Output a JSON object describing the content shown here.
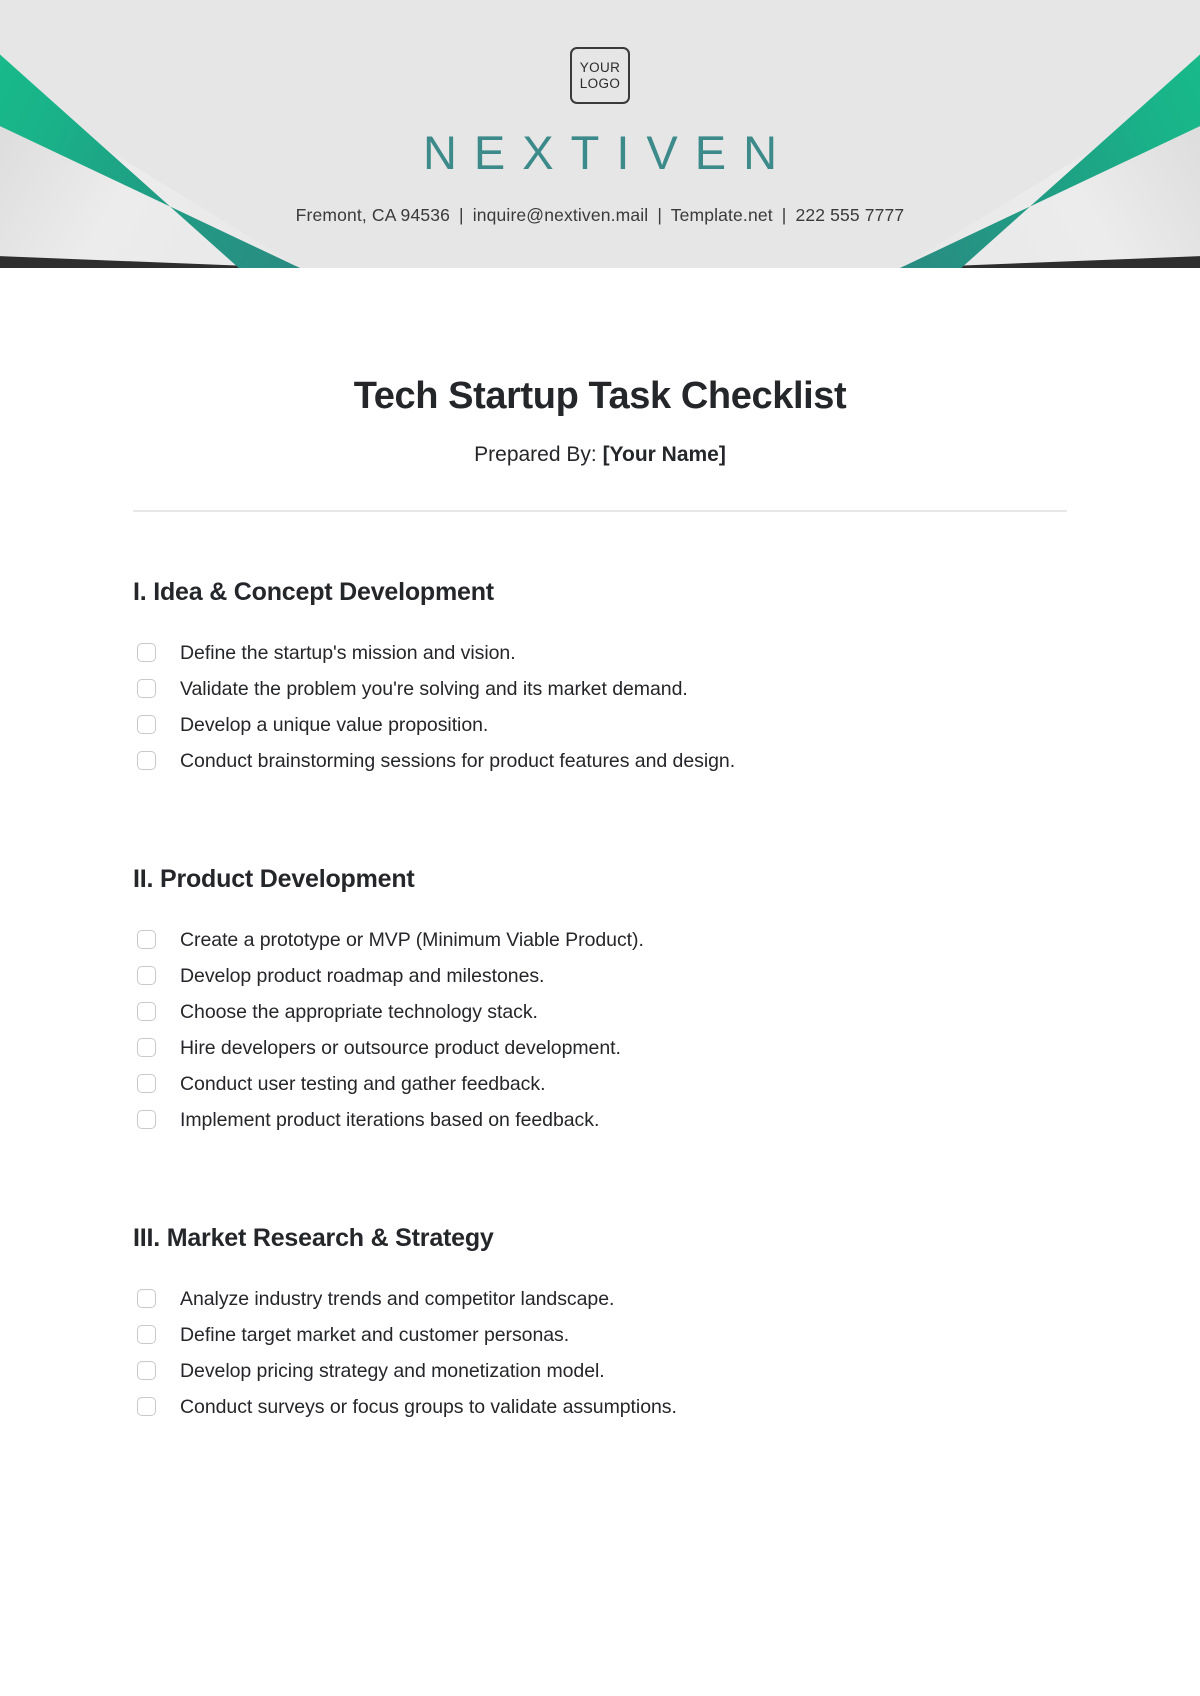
{
  "header": {
    "logo": {
      "line1": "YOUR",
      "line2": "LOGO"
    },
    "brand_name": "NEXTIVEN",
    "contact": {
      "address": "Fremont, CA 94536",
      "email": "inquire@nextiven.mail",
      "website": "Template.net",
      "phone": "222 555 7777",
      "separator": "|"
    },
    "colors": {
      "banner_background": "#e6e6e6",
      "brand_teal": "#3d8a8a",
      "accent_green": "#19b489",
      "accent_dark": "#2e2e2e"
    }
  },
  "document": {
    "title": "Tech Startup Task Checklist",
    "prepared_by_label": "Prepared By:",
    "prepared_by_value": "[Your Name]"
  },
  "sections": [
    {
      "heading": "I. Idea & Concept Development",
      "items": [
        "Define the startup's mission and vision.",
        "Validate the problem you're solving and its market demand.",
        "Develop a unique value proposition.",
        "Conduct brainstorming sessions for product features and design."
      ]
    },
    {
      "heading": "II. Product Development",
      "items": [
        "Create a prototype or MVP (Minimum Viable Product).",
        "Develop product roadmap and milestones.",
        "Choose the appropriate technology stack.",
        "Hire developers or outsource product development.",
        "Conduct user testing and gather feedback.",
        "Implement product iterations based on feedback."
      ]
    },
    {
      "heading": "III. Market Research & Strategy",
      "items": [
        "Analyze industry trends and competitor landscape.",
        "Define target market and customer personas.",
        "Develop pricing strategy and monetization model.",
        "Conduct surveys or focus groups to validate assumptions."
      ]
    }
  ]
}
